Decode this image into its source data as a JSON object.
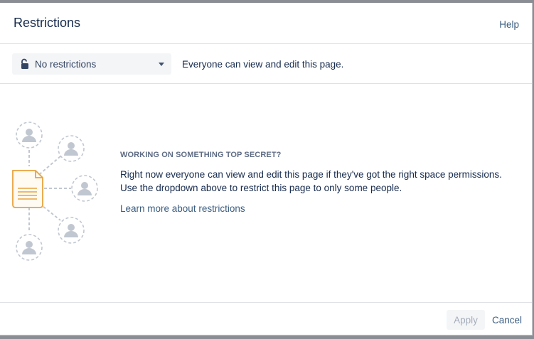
{
  "dialog": {
    "title": "Restrictions",
    "help_label": "Help"
  },
  "restriction_select": {
    "selected": "No restrictions",
    "icon": "unlock-icon"
  },
  "toolbar": {
    "description": "Everyone can view and edit this page."
  },
  "empty_state": {
    "heading": "WORKING ON SOMETHING TOP SECRET?",
    "line1": "Right now everyone can view and edit this page if they've got the right space permissions.",
    "line2": "Use the dropdown above to restrict this page to only some people.",
    "learn_more": "Learn more about restrictions"
  },
  "footer": {
    "apply_label": "Apply",
    "cancel_label": "Cancel"
  },
  "colors": {
    "link": "#3b5d80",
    "document_accent": "#e8a33d",
    "avatar_gray": "#c1c7d0"
  }
}
